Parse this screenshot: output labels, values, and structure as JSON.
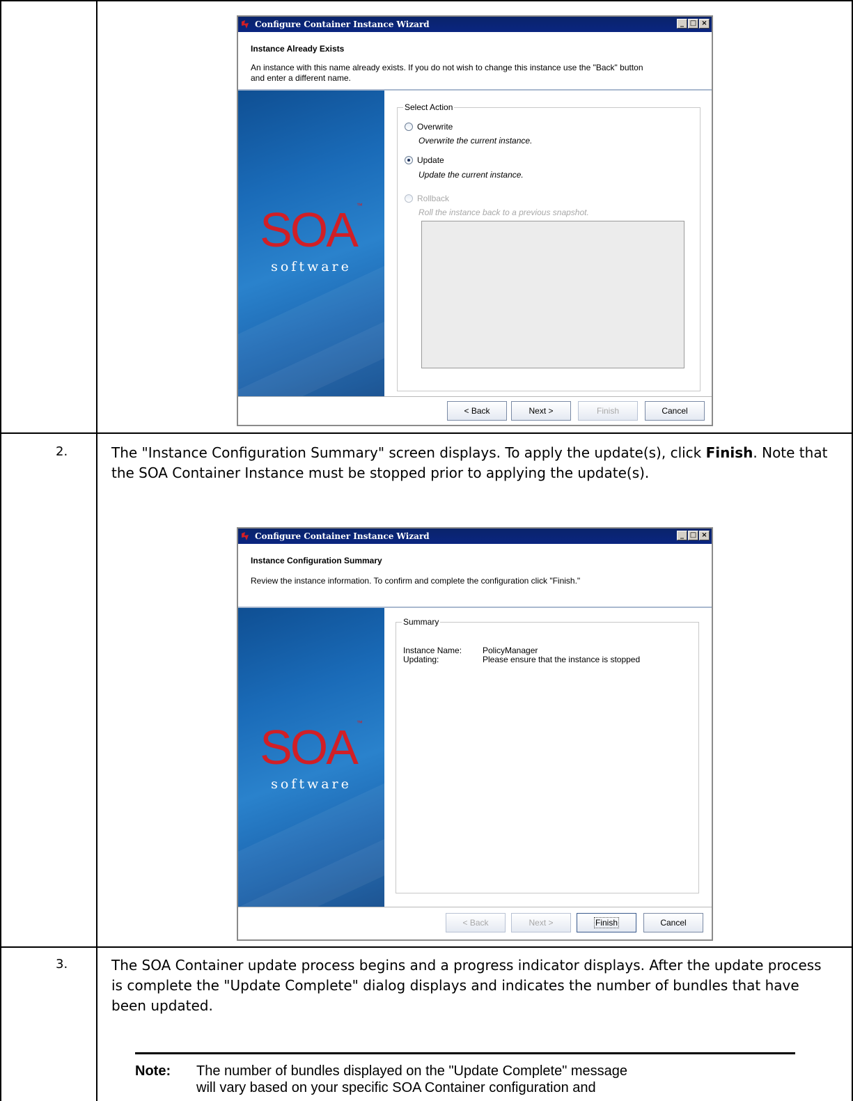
{
  "wizard1": {
    "title": "Configure Container Instance Wizard",
    "heading": "Instance Already Exists",
    "description_line1": "An instance with this name already exists.  If you do not wish to change this instance use the \"Back\" button",
    "description_line2": "and enter a different name.",
    "group_title": "Select Action",
    "options": [
      {
        "label": "Overwrite",
        "description": "Overwrite the current instance.",
        "checked": false,
        "enabled": true
      },
      {
        "label": "Update",
        "description": "Update the current instance.",
        "checked": true,
        "enabled": true
      },
      {
        "label": "Rollback",
        "description": "Roll the instance back to a previous snapshot.",
        "checked": false,
        "enabled": false
      }
    ],
    "logo_text": "SOA",
    "logo_tm": "™",
    "logo_sub": "software",
    "buttons": {
      "back": "< Back",
      "next": "Next >",
      "finish": "Finish",
      "cancel": "Cancel"
    }
  },
  "steps": [
    {
      "number": "2.",
      "text_before": "The \"Instance Configuration Summary\" screen displays. To apply the update(s), click ",
      "bold": "Finish",
      "text_after": ". Note that the SOA Container Instance must be stopped prior to applying the update(s)."
    },
    {
      "number": "3.",
      "text": "The SOA Container update process begins and a progress indicator displays. After the update process is complete the \"Update Complete\" dialog displays and indicates the number of bundles that have been updated."
    }
  ],
  "wizard2": {
    "title": "Configure Container Instance Wizard",
    "heading": "Instance Configuration Summary",
    "description": "Review the instance information. To confirm and complete the configuration click \"Finish.\"",
    "group_title": "Summary",
    "rows": [
      {
        "label": "Instance Name:",
        "value": "PolicyManager"
      },
      {
        "label": "Updating:",
        "value": "Please ensure that the instance is stopped"
      }
    ],
    "logo_text": "SOA",
    "logo_tm": "™",
    "logo_sub": "software",
    "buttons": {
      "back": "< Back",
      "next": "Next >",
      "finish": "Finish",
      "cancel": "Cancel"
    }
  },
  "note": {
    "label": "Note:",
    "line1": "The number of bundles displayed on the \"Update Complete\" message",
    "line2": "will vary based on your specific SOA Container configuration and"
  }
}
